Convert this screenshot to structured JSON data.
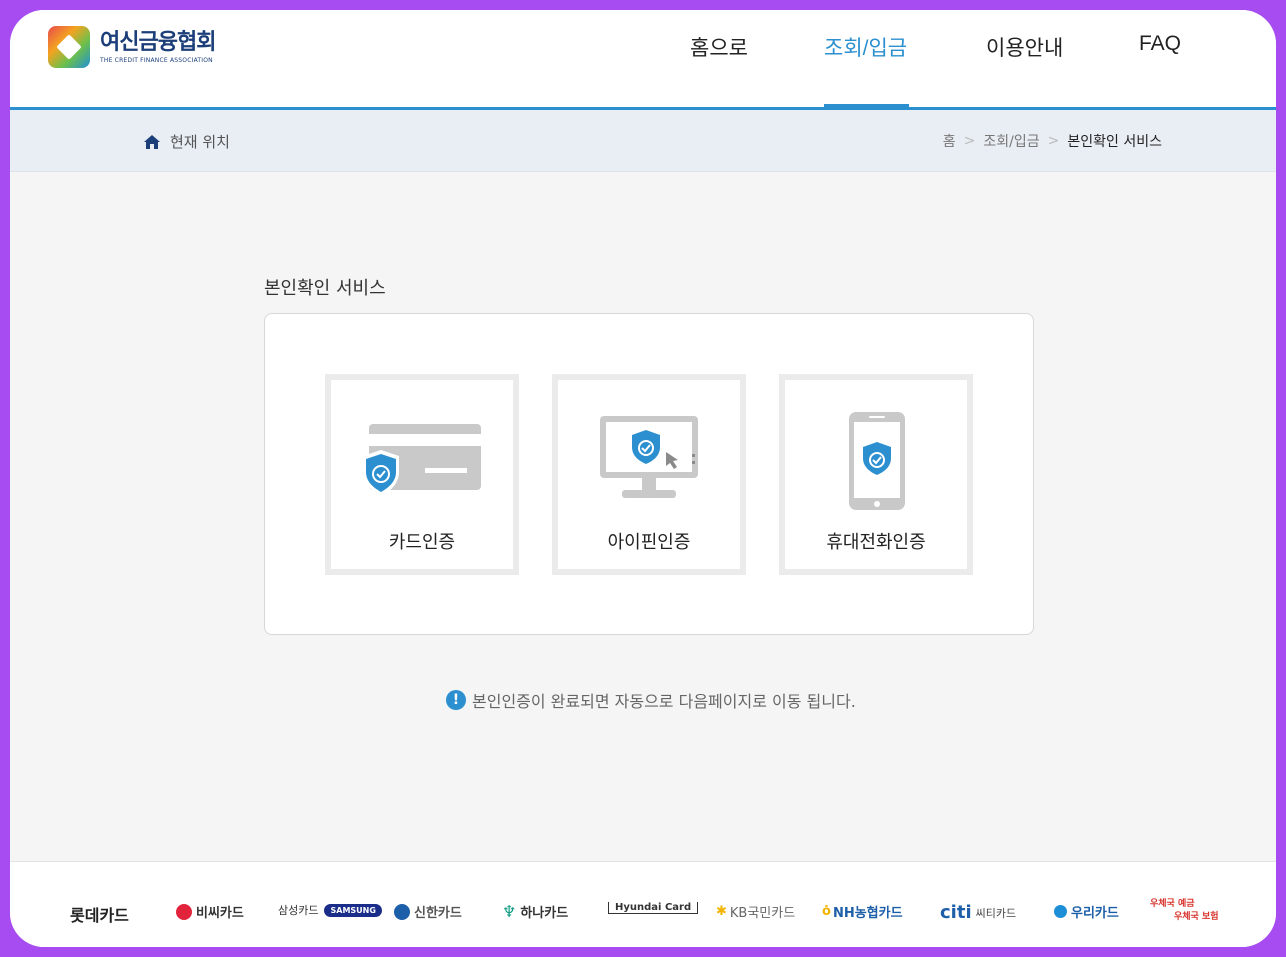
{
  "header": {
    "logo_kr": "여신금융협회",
    "logo_en": "THE CREDIT FINANCE ASSOCIATION",
    "nav": [
      "홈으로",
      "조회/입금",
      "이용안내",
      "FAQ"
    ],
    "active_nav": "조회/입금",
    "accent_color": "#2c8fd0"
  },
  "location": {
    "label": "현재 위치",
    "breadcrumb": [
      "홈",
      "조회/입금",
      "본인확인 서비스"
    ],
    "separator": ">"
  },
  "main": {
    "title": "본인확인 서비스",
    "cards": [
      {
        "label": "카드인증",
        "icon": "card-shield-icon"
      },
      {
        "label": "아이핀인증",
        "icon": "monitor-shield-icon"
      },
      {
        "label": "휴대전화인증",
        "icon": "phone-shield-icon"
      }
    ],
    "notice": "본인인증이 완료되면 자동으로 다음페이지로 이동 됩니다."
  },
  "footer": {
    "partners": [
      "롯데카드",
      "비씨카드",
      "삼성카드",
      "SAMSUNG",
      "신한카드",
      "하나카드",
      "Hyundai Card",
      "KB국민카드",
      "NH농협카드",
      "citi",
      "씨티카드",
      "우리카드",
      "우체국 예금",
      "우체국 보험"
    ]
  }
}
